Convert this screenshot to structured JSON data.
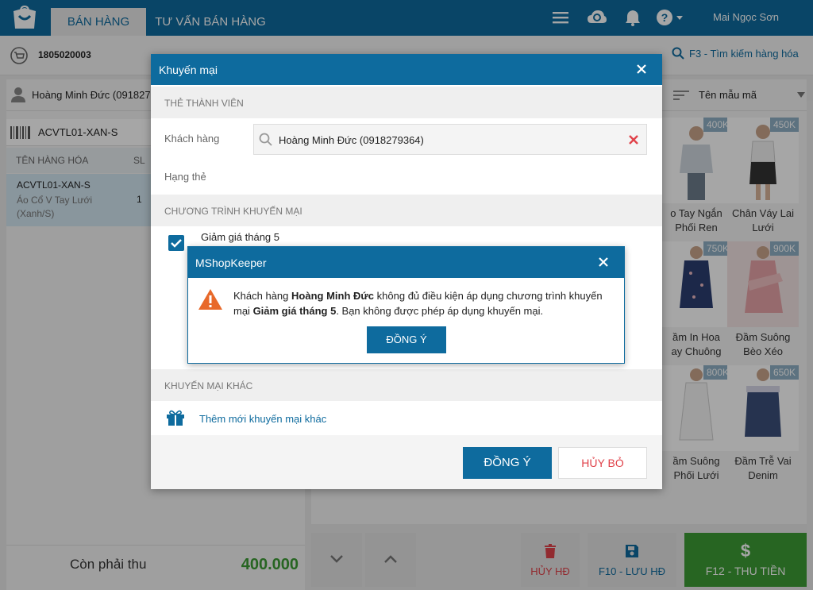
{
  "topbar": {
    "tabs": [
      "BÁN HÀNG",
      "TƯ VẤN BÁN HÀNG"
    ],
    "user_name": "Mai Ngọc Sơn",
    "icons": [
      "menu-icon",
      "cloud-sync-icon",
      "bell-icon",
      "help-icon"
    ]
  },
  "subbar": {
    "invoice_no": "1805020003",
    "search_hint": "F3 - Tìm kiếm hàng hóa"
  },
  "left": {
    "customer": "Hoàng Minh Đức (091827",
    "barcode": "ACVTL01-XAN-S",
    "cart_headers": [
      "TÊN HÀNG HÓA",
      "SL"
    ],
    "cart_items": [
      {
        "code": "ACVTL01-XAN-S",
        "name": "Áo Cổ V Tay Lưới (Xanh/S)",
        "qty": "1"
      }
    ],
    "total_label": "Còn phải thu",
    "total_value": "400.000"
  },
  "right": {
    "filter_label": "Tên mẫu mã",
    "products": [
      {
        "price": "400K",
        "name1": "o Tay Ngắn",
        "name2": "Phối Ren"
      },
      {
        "price": "450K",
        "name1": "Chân Váy Lai",
        "name2": "Lưới"
      },
      {
        "price": "750K",
        "name1": "ầm In Hoa",
        "name2": "ay Chuông"
      },
      {
        "price": "900K",
        "name1": "Đầm Suông",
        "name2": "Bèo Xéo"
      },
      {
        "price": "800K",
        "name1": "ầm Suông",
        "name2": "Phối Lưới"
      },
      {
        "price": "650K",
        "name1": "Đầm Trễ Vai",
        "name2": "Denim"
      }
    ]
  },
  "actions": {
    "cancel_label": "HỦY HĐ",
    "save_label": "F10 - LƯU HĐ",
    "pay_label": "F12 - THU TIỀN"
  },
  "dialog": {
    "title": "Khuyến mại",
    "section_member": "THẺ THÀNH VIÊN",
    "customer_label": "Khách hàng",
    "customer_value": "Hoàng Minh Đức (0918279364)",
    "card_rank_label": "Hạng thẻ",
    "section_promo": "CHƯƠNG TRÌNH KHUYẾN MẠI",
    "promo_name": "Giảm giá tháng 5",
    "section_other": "KHUYẾN MẠI KHÁC",
    "add_promo": "Thêm mới khuyến mại khác",
    "ok_label": "ĐỒNG Ý",
    "cancel_label": "HỦY BỎ"
  },
  "alert": {
    "title": "MShopKeeper",
    "msg_part1": "Khách hàng ",
    "msg_customer": "Hoàng Minh Đức",
    "msg_part2": " không đủ điều kiện áp dụng chương trình khuyến mại ",
    "msg_promo": "Giảm giá tháng 5",
    "msg_part3": ". Bạn không được phép áp dụng khuyến mại.",
    "ok_label": "ĐỒNG Ý"
  },
  "colors": {
    "primary": "#0e6b9e",
    "success": "#3d9b35",
    "danger": "#e0424a",
    "warning": "#e8692a"
  }
}
